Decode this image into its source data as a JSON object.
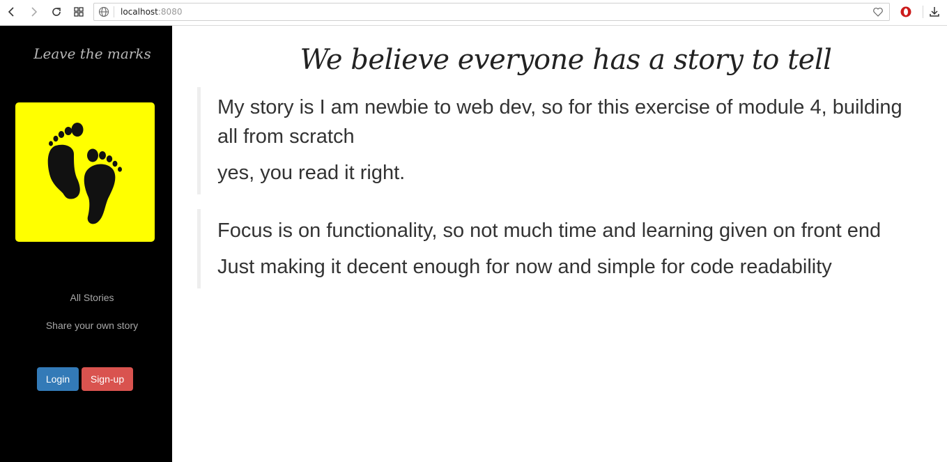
{
  "browser": {
    "url_host": "localhost",
    "url_port": ":8080"
  },
  "sidebar": {
    "title": "Leave the marks",
    "links": [
      {
        "label": "All Stories"
      },
      {
        "label": "Share your own story"
      }
    ],
    "login_label": "Login",
    "signup_label": "Sign-up",
    "logo_bg": "#ffff00"
  },
  "main": {
    "headline": "We believe everyone has a story to tell",
    "quotes": [
      {
        "line1": "My story is I am newbie to web dev, so for this exercise of module 4, building all from scratch",
        "line2": "yes, you read it right."
      },
      {
        "line1": "Focus is on functionality, so not much time and learning given on front end",
        "line2": "Just making it decent enough for now and simple for code readability"
      }
    ]
  },
  "colors": {
    "login": "#337ab7",
    "signup": "#d9534f",
    "sidebar": "#000000"
  }
}
